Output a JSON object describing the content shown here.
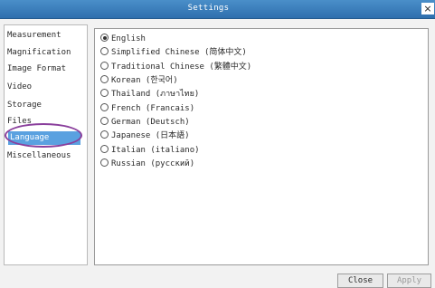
{
  "window": {
    "title": "Settings",
    "close_glyph": "×"
  },
  "sidebar": {
    "items": [
      {
        "label": "Measurement"
      },
      {
        "label": "Magnification"
      },
      {
        "label": "Image Format"
      },
      {
        "label": "Video"
      },
      {
        "label": "Storage"
      },
      {
        "label": "Files"
      },
      {
        "label": "Language",
        "selected": true
      },
      {
        "label": "Miscellaneous"
      }
    ]
  },
  "language": {
    "selected_index": 0,
    "options": [
      {
        "label": "English",
        "checked": true
      },
      {
        "label": "Simplified Chinese (简体中文)"
      },
      {
        "label": "Traditional Chinese (繁體中文)"
      },
      {
        "label": "Korean (한국어)"
      },
      {
        "label": "Thailand (ภาษาไทย)"
      },
      {
        "label": "French (Francais)"
      },
      {
        "label": "German (Deutsch)"
      },
      {
        "label": "Japanese (日本語)"
      },
      {
        "label": "Italian (italiano)"
      },
      {
        "label": "Russian (русский)"
      }
    ]
  },
  "buttons": {
    "close_label": "Close",
    "apply_label": "Apply"
  },
  "colors": {
    "titlebar": "#3a7fbf",
    "selected_item": "#5aa1e0",
    "annotation_ring": "#8a3f9c"
  }
}
